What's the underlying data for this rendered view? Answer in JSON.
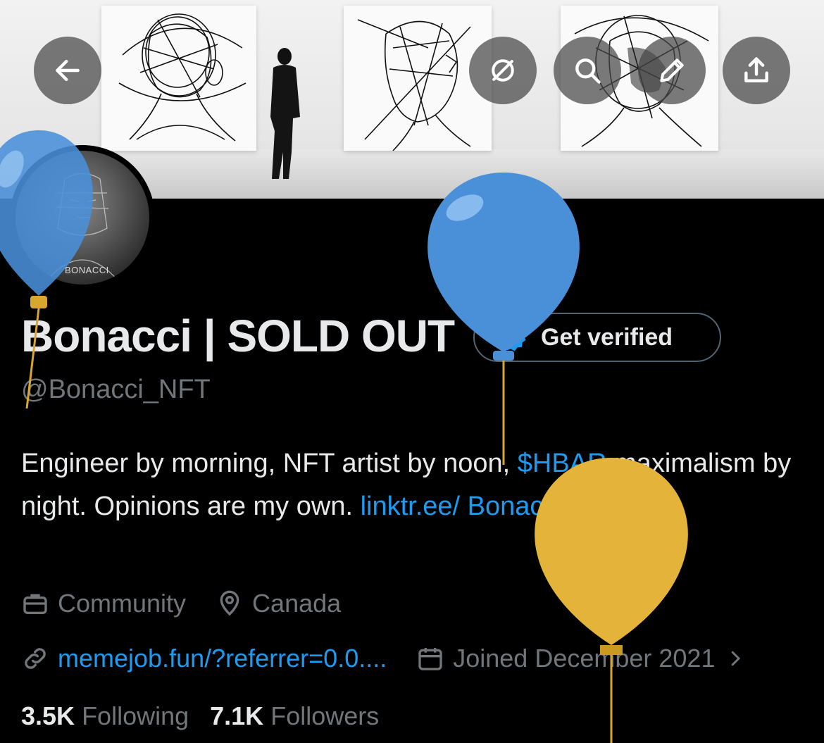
{
  "header": {
    "back_icon": "arrow-left-icon",
    "actions": [
      "grok-icon",
      "search-icon",
      "edit-icon",
      "share-icon"
    ]
  },
  "avatar": {
    "tag": "BONACCI"
  },
  "profile": {
    "display_name": "Bonacci | SOLD OUT",
    "handle": "@Bonacci_NFT",
    "verify_label": "Get verified",
    "bio_part1": "Engineer by morning, NFT artist by noon, ",
    "bio_cashtag": "$HBAR",
    "bio_part2": " maximalism by night. Opinions are my own. ",
    "bio_link": "linktr.ee/ Bonacci.NFT",
    "category": "Community",
    "location": "Canada",
    "website": "memejob.fun/?referrer=0.0....",
    "joined": "Joined December 2021",
    "following_count": "3.5K",
    "following_label": "Following",
    "followers_count": "7.1K",
    "followers_label": "Followers"
  },
  "colors": {
    "accent": "#1d9bf0",
    "muted": "#71767b",
    "balloon_blue": "#4a90d9",
    "balloon_yellow": "#e3b33a"
  }
}
